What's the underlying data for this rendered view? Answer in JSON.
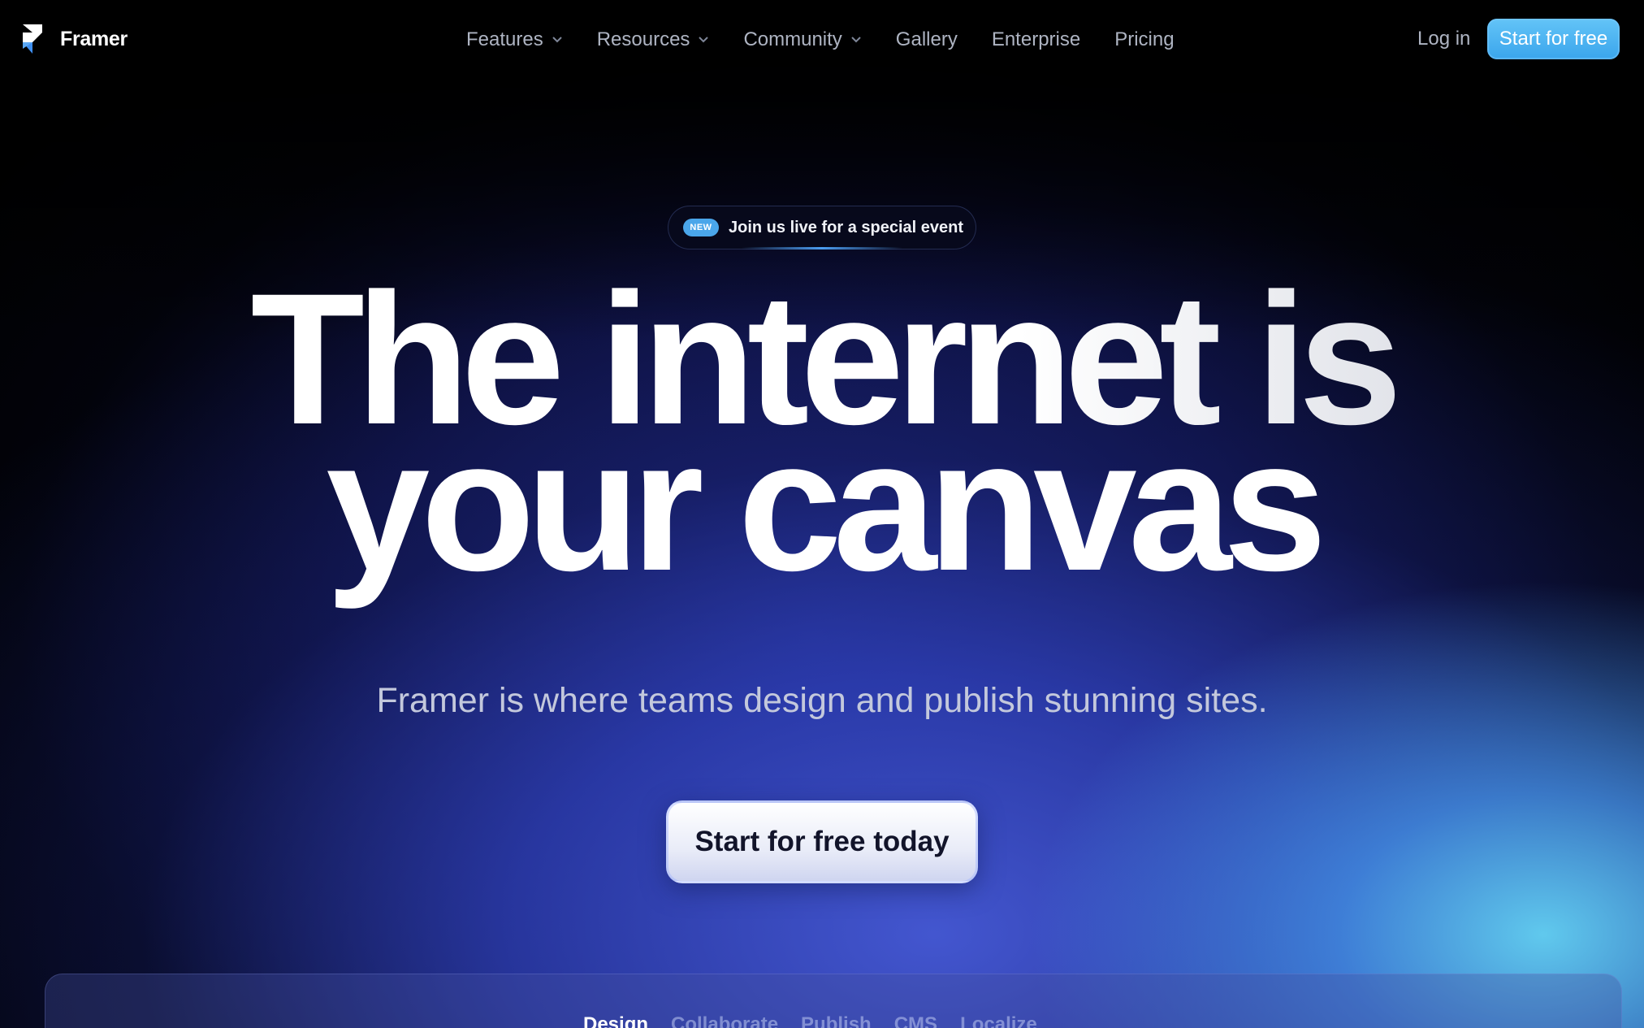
{
  "brand": {
    "name": "Framer",
    "logo_icon": "framer-logo-icon"
  },
  "nav": {
    "items": [
      {
        "label": "Features",
        "has_dropdown": true
      },
      {
        "label": "Resources",
        "has_dropdown": true
      },
      {
        "label": "Community",
        "has_dropdown": true
      },
      {
        "label": "Gallery",
        "has_dropdown": false
      },
      {
        "label": "Enterprise",
        "has_dropdown": false
      },
      {
        "label": "Pricing",
        "has_dropdown": false
      }
    ],
    "login_label": "Log in",
    "cta_label": "Start for free"
  },
  "announcement": {
    "badge": "NEW",
    "text": "Join us live for a special event"
  },
  "hero": {
    "headline_line1": "The internet is",
    "headline_line2": "your canvas",
    "subtitle": "Framer is where teams design and publish stunning sites.",
    "cta_label": "Start for free today"
  },
  "tabs": [
    {
      "label": "Design",
      "active": true
    },
    {
      "label": "Collaborate",
      "active": false
    },
    {
      "label": "Publish",
      "active": false
    },
    {
      "label": "CMS",
      "active": false
    },
    {
      "label": "Localize",
      "active": false
    }
  ],
  "colors": {
    "accent": "#3aa5ec",
    "nav_text": "#aeb4c2",
    "background": "#000000"
  }
}
